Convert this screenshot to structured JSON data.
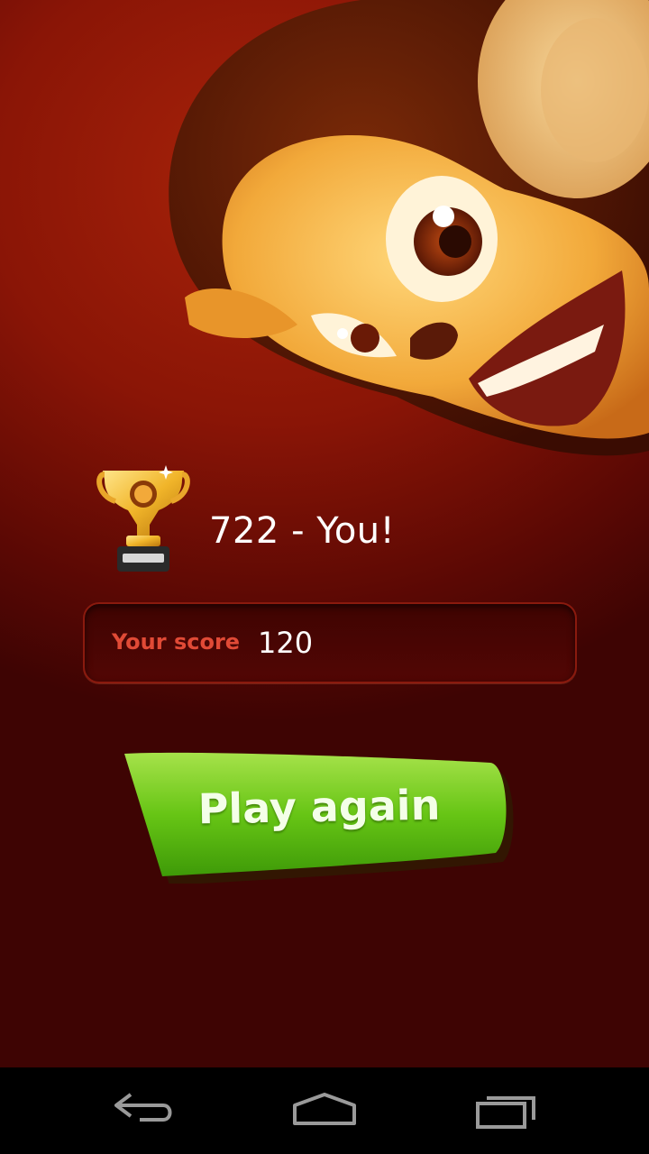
{
  "leaderboard": {
    "rank_text": "722 - You!"
  },
  "score": {
    "label": "Your score",
    "value": "120"
  },
  "actions": {
    "play_again_label": "Play again"
  },
  "navbar": {
    "back_icon": "back-icon",
    "home_icon": "home-icon",
    "recents_icon": "recents-icon"
  },
  "colors": {
    "background": "#8a1506",
    "button_green": "#5cc012",
    "score_label": "#e04a36"
  }
}
